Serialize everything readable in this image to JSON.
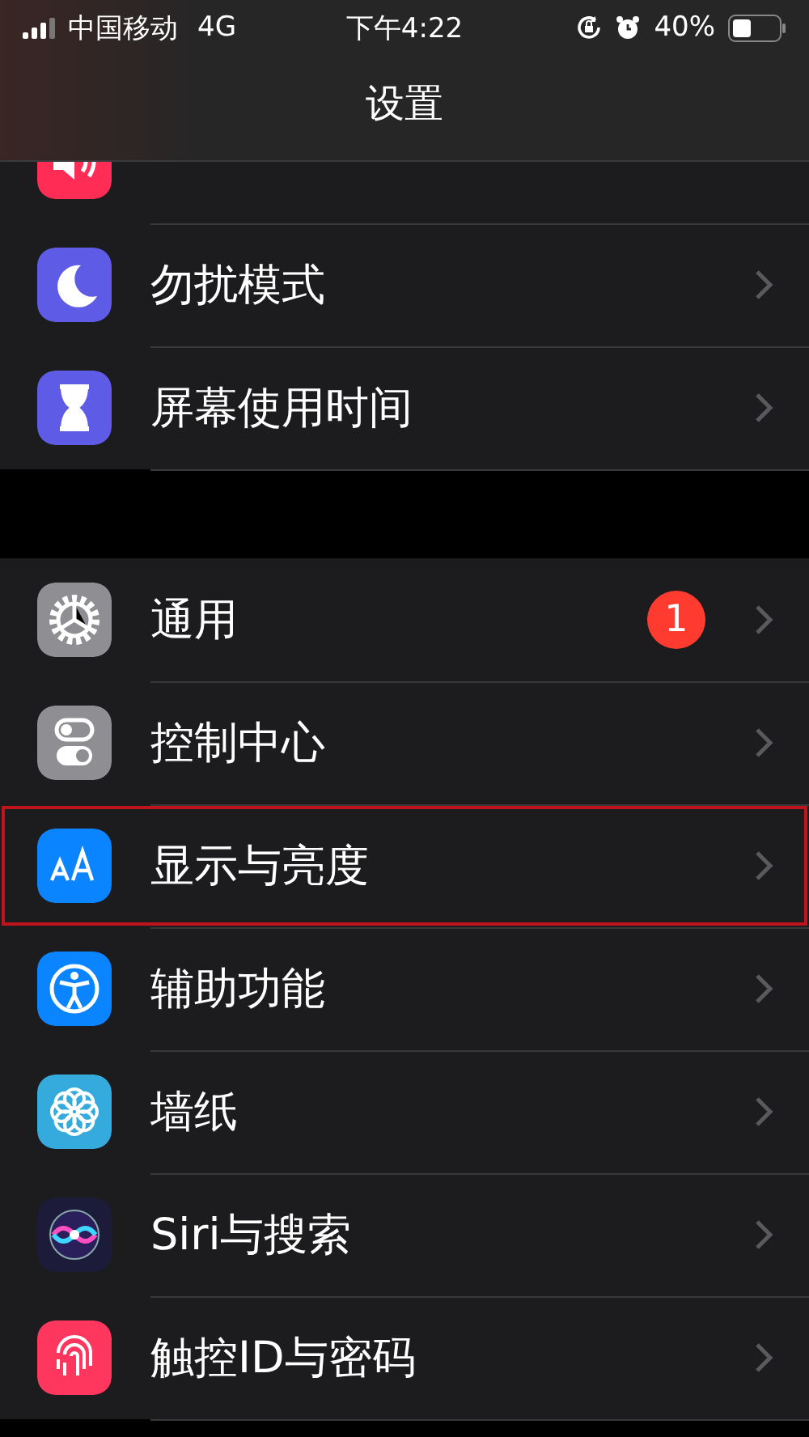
{
  "status_bar": {
    "carrier": "中国移动",
    "network": "4G",
    "time": "下午4:22",
    "battery": "40%"
  },
  "nav": {
    "title": "设置"
  },
  "groups": [
    {
      "items": [
        {
          "color": "#ff2d55",
          "highlighted": false
        },
        {
          "label": "勿扰模式",
          "color": "#5e5ce6",
          "highlighted": false
        },
        {
          "label": "屏幕使用时间",
          "color": "#5e5ce6",
          "highlighted": false
        }
      ]
    },
    {
      "items": [
        {
          "label": "通用",
          "color": "#8e8e93",
          "badge": "1",
          "highlighted": false
        },
        {
          "label": "控制中心",
          "color": "#8e8e93",
          "highlighted": false
        },
        {
          "label": "显示与亮度",
          "color": "#0a84ff",
          "highlighted": true
        },
        {
          "label": "辅助功能",
          "color": "#0a84ff",
          "highlighted": false
        },
        {
          "label": "墙纸",
          "color": "#35aadc",
          "highlighted": false
        },
        {
          "label": "Siri与搜索",
          "color": "#1c1c3a",
          "highlighted": false
        },
        {
          "label": "触控ID与密码",
          "color": "#ff375f",
          "highlighted": false
        }
      ]
    }
  ]
}
